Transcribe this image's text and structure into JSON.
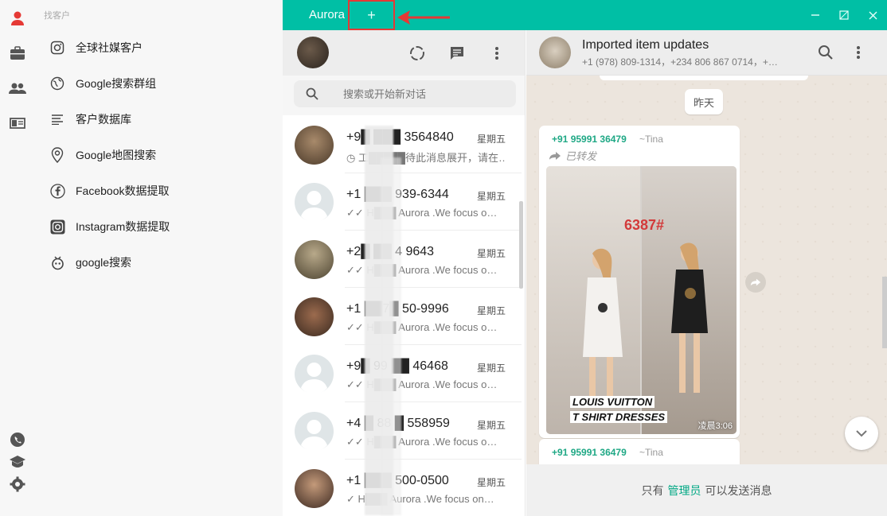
{
  "sidebar": {
    "icons": [
      "user-icon",
      "briefcase-icon",
      "contacts-icon",
      "book-icon"
    ],
    "bottom_icons": [
      "whatsapp-icon",
      "graduation-cap-icon",
      "settings-icon"
    ]
  },
  "menu": {
    "header": "找客户",
    "items": [
      {
        "label": "全球社媒客户",
        "icon": "instagram-outline-icon"
      },
      {
        "label": "Google搜索群组",
        "icon": "globe-icon"
      },
      {
        "label": "客户数据库",
        "icon": "list-icon"
      },
      {
        "label": "Google地图搜索",
        "icon": "map-pin-icon"
      },
      {
        "label": "Facebook数据提取",
        "icon": "facebook-icon"
      },
      {
        "label": "Instagram数据提取",
        "icon": "instagram-icon"
      },
      {
        "label": "google搜索",
        "icon": "search-bot-icon"
      }
    ]
  },
  "topbar": {
    "tab_label": "Aurora",
    "add_tab": "+",
    "accent": "#00bfa5"
  },
  "chatlist": {
    "search_placeholder": "搜索或开始新对话",
    "rows": [
      {
        "name": "+9█ ███ 3564840",
        "day": "星期五",
        "preview": "◷ 工█████待此消息展开，请在…",
        "avatar": "#7a6a55"
      },
      {
        "name": "+1 ███ 939-6344",
        "day": "星期五",
        "preview": "✓✓ H███ Aurora .We focus o…",
        "avatar": "#dfe5e7"
      },
      {
        "name": "+2█ ██ 4 9643",
        "day": "星期五",
        "preview": "✓✓ H███ Aurora .We focus o…",
        "avatar": "#6e6651"
      },
      {
        "name": "+1 ██7█ 50-9996",
        "day": "星期五",
        "preview": "✓✓ H███ Aurora .We focus o…",
        "avatar": "#5a3e2e"
      },
      {
        "name": "+9█ 99 ██ 46468",
        "day": "星期五",
        "preview": "✓✓ H███ Aurora .We focus o…",
        "avatar": "#dfe5e7"
      },
      {
        "name": "+4 █ 88 █ 558959",
        "day": "星期五",
        "preview": "✓✓ H███ Aurora .We focus o…",
        "avatar": "#dfe5e7"
      },
      {
        "name": "+1 ███ 500-0500",
        "day": "星期五",
        "preview": "✓ H███ Aurora .We focus on…",
        "avatar": "#6b4b3a"
      }
    ]
  },
  "conversation": {
    "title": "Imported item updates",
    "subtitle": "+1 (978) 809-1314，+234 806 867 0714，+…",
    "date_badge": "昨天",
    "message": {
      "sender": "+91 95991 36479",
      "nick": "~Tina",
      "forwarded": "已转发",
      "image_code": "6387#",
      "image_caption_1": "LOUIS VUITTON",
      "image_caption_2": "T SHIRT DRESSES",
      "time": "凌晨3:06"
    },
    "message2": {
      "sender": "+91 95991 36479",
      "nick": "~Tina"
    },
    "footer_pre": "只有",
    "footer_admin": "管理员",
    "footer_post": "可以发送消息"
  }
}
